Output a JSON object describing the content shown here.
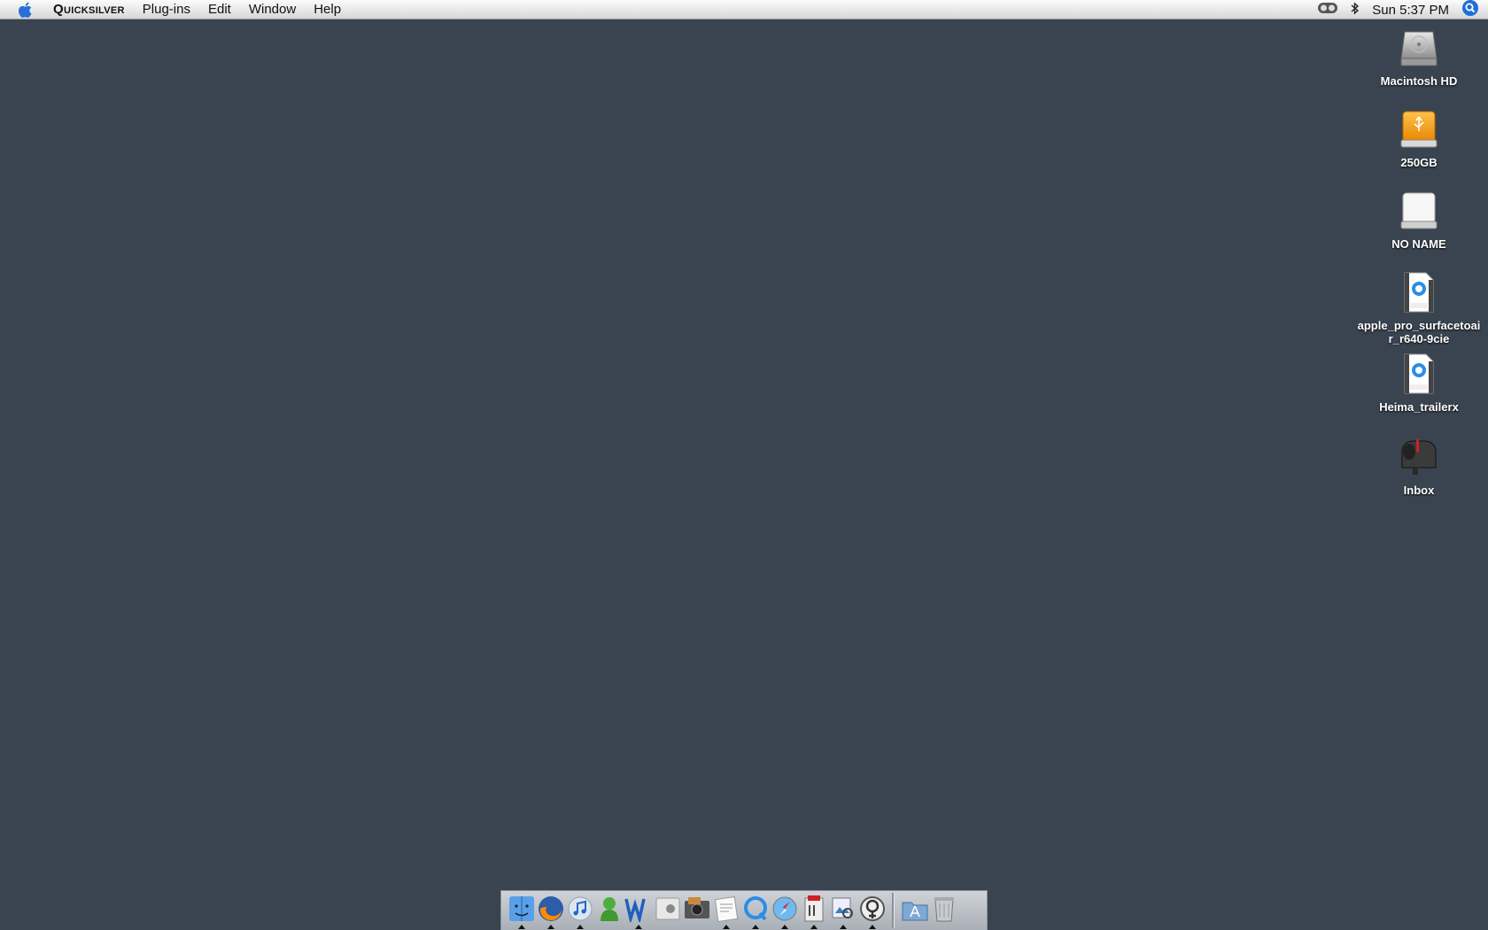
{
  "menubar": {
    "app_name": "Quicksilver",
    "menus": [
      "Plug-ins",
      "Edit",
      "Window",
      "Help"
    ],
    "clock": "Sun 5:37 PM",
    "status_icons": [
      "display-mirror-icon",
      "bluetooth-icon",
      "spotlight-icon"
    ]
  },
  "desktop": {
    "background_color": "#3a4450",
    "icons": [
      {
        "label": "Macintosh HD",
        "icon": "hard-drive-icon"
      },
      {
        "label": "250GB",
        "icon": "usb-drive-icon"
      },
      {
        "label": "NO NAME",
        "icon": "removable-disk-icon"
      },
      {
        "label": "apple_pro_surfacetoair_r640-9cie",
        "icon": "quicktime-movie-icon"
      },
      {
        "label": "Heima_trailerx",
        "icon": "quicktime-movie-icon"
      },
      {
        "label": "Inbox",
        "icon": "mailbox-icon"
      }
    ]
  },
  "dock": {
    "apps": [
      {
        "name": "finder-icon",
        "running": true
      },
      {
        "name": "firefox-icon",
        "running": true
      },
      {
        "name": "itunes-icon",
        "running": true
      },
      {
        "name": "adium-icon",
        "running": false
      },
      {
        "name": "word-icon",
        "running": true
      },
      {
        "name": "system-preferences-icon",
        "running": false
      },
      {
        "name": "iphoto-icon",
        "running": false
      },
      {
        "name": "textedit-icon",
        "running": true
      },
      {
        "name": "quicktime-icon",
        "running": true
      },
      {
        "name": "safari-icon",
        "running": true
      },
      {
        "name": "script-editor-icon",
        "running": true
      },
      {
        "name": "preview-icon",
        "running": true
      },
      {
        "name": "quicksilver-icon",
        "running": true
      }
    ],
    "others": [
      "applications-folder-icon",
      "trash-icon"
    ]
  }
}
